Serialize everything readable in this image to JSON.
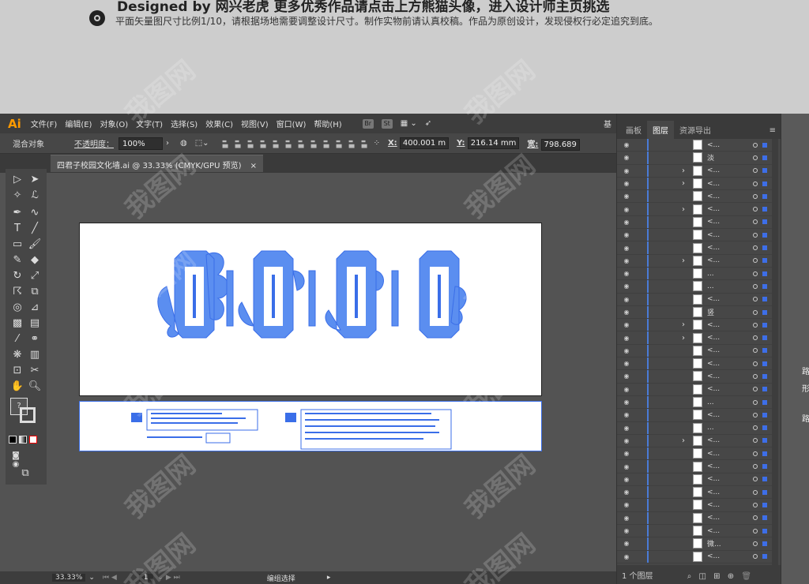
{
  "banner": {
    "headline": "Designed by 网兴老虎  更多优秀作品请点击上方熊猫头像，进入设计师主页挑选",
    "note": "平面矢量图尺寸比例1/10，请根据场地需要调整设计尺寸。制作实物前请认真校稿。作品为原创设计，发现侵权行必定追究到底。"
  },
  "app": {
    "logo": "Ai",
    "menus": [
      "文件(F)",
      "编辑(E)",
      "对象(O)",
      "文字(T)",
      "选择(S)",
      "效果(C)",
      "视图(V)",
      "窗口(W)",
      "帮助(H)"
    ],
    "menu_icons": [
      "Br",
      "St"
    ],
    "workspace": "基"
  },
  "control": {
    "mixed_objects": "混合对象",
    "opacity_label": "不透明度：",
    "opacity_value": "100%",
    "x_label": "X:",
    "x_value": "400.001 m",
    "y_label": "Y:",
    "y_value": "216.14 mm",
    "w_label": "宽:",
    "w_value": "798.689"
  },
  "document": {
    "tab_title": "四君子校园文化墙.ai @ 33.33% (CMYK/GPU 预览)",
    "close": "×"
  },
  "status": {
    "zoom": "33.33%",
    "page": "1",
    "mode": "编组选择"
  },
  "panel": {
    "tabs": [
      "画板",
      "图层",
      "资源导出"
    ],
    "active_tab": "图层",
    "layer_count": "1 个图层",
    "rows": [
      {
        "name": "<...",
        "chev": false
      },
      {
        "name": "淡",
        "chev": false
      },
      {
        "name": "<...",
        "chev": true
      },
      {
        "name": "<...",
        "chev": true
      },
      {
        "name": "<...",
        "chev": false
      },
      {
        "name": "<...",
        "chev": true
      },
      {
        "name": "<...",
        "chev": false
      },
      {
        "name": "<...",
        "chev": false
      },
      {
        "name": "<...",
        "chev": false
      },
      {
        "name": "<...",
        "chev": true
      },
      {
        "name": "...",
        "chev": false
      },
      {
        "name": "...",
        "chev": false
      },
      {
        "name": "<...",
        "chev": false
      },
      {
        "name": "竖",
        "chev": false
      },
      {
        "name": "<...",
        "chev": true
      },
      {
        "name": "<...",
        "chev": true
      },
      {
        "name": "<...",
        "chev": false
      },
      {
        "name": "<...",
        "chev": false
      },
      {
        "name": "<...",
        "chev": false
      },
      {
        "name": "<...",
        "chev": false
      },
      {
        "name": "...",
        "chev": false
      },
      {
        "name": "<...",
        "chev": false
      },
      {
        "name": "...",
        "chev": false
      },
      {
        "name": "<...",
        "chev": true
      },
      {
        "name": "<...",
        "chev": false
      },
      {
        "name": "<...",
        "chev": false
      },
      {
        "name": "<...",
        "chev": false
      },
      {
        "name": "<...",
        "chev": false
      },
      {
        "name": "<...",
        "chev": false
      },
      {
        "name": "<...",
        "chev": false
      },
      {
        "name": "<...",
        "chev": false
      },
      {
        "name": "微...",
        "chev": false
      },
      {
        "name": "<...",
        "chev": false
      }
    ]
  },
  "watermark": "我图网"
}
